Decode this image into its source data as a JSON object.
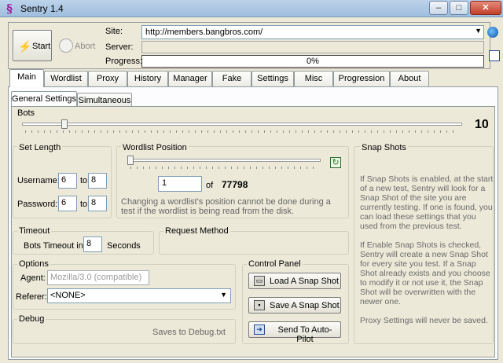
{
  "window": {
    "title": "Sentry 1.4",
    "icon_glyph": "§",
    "minimize_glyph": "–",
    "maximize_glyph": "□",
    "close_glyph": "✕"
  },
  "top": {
    "start_label": "Start",
    "start_icon": "⚡",
    "abort_label": "Abort",
    "site_label": "Site:",
    "site_value": "http://members.bangbros.com/",
    "combo_arrow": "▼",
    "server_label": "Server:",
    "progress_label": "Progress:",
    "progress_text": "0%",
    "progress_fraction": 0
  },
  "tabs": [
    {
      "label": "Main"
    },
    {
      "label": "Wordlist"
    },
    {
      "label": "Proxy"
    },
    {
      "label": "History"
    },
    {
      "label": "Manager"
    },
    {
      "label": "Fake"
    },
    {
      "label": "Settings"
    },
    {
      "label": "Misc"
    },
    {
      "label": "Progression"
    },
    {
      "label": "About"
    }
  ],
  "subtabs": [
    {
      "label": "General Settings"
    },
    {
      "label": "Simultaneous"
    }
  ],
  "bots": {
    "title": "Bots",
    "value": "10"
  },
  "set_length": {
    "title": "Set Length",
    "username_label": "Username:",
    "username_min": "6",
    "username_max": "8",
    "password_label": "Password:",
    "password_min": "6",
    "password_max": "8",
    "to": "to"
  },
  "wordlist_position": {
    "title": "Wordlist Position",
    "position": "1",
    "of": "of",
    "total": "77798",
    "note": "Changing a wordlist's position cannot be done during a test if the wordlist is being read from the disk."
  },
  "snap_shots": {
    "title": "Snap Shots",
    "para1": "If Snap Shots is enabled, at the start of a new test, Sentry will look for a Snap Shot of the site you are currently testing. If one is found, you can load these settings that you used from the previous test.",
    "para2": "If Enable Snap Shots is checked, Sentry will create a new Snap Shot for every site you test.  If a Snap Shot already exists and you choose to modify it or not use it, the Snap Shot will be overwritten with the newer one.",
    "para3": "Proxy Settings will never be saved."
  },
  "timeout": {
    "title": "Timeout",
    "label": "Bots Timeout in",
    "value": "8",
    "unit": "Seconds"
  },
  "request_method": {
    "title": "Request Method"
  },
  "options": {
    "title": "Options",
    "agent_label": "Agent:",
    "agent_placeholder": "Mozilla/3.0 (compatible)",
    "referer_label": "Referer:",
    "referer_value": "<NONE>"
  },
  "control_panel": {
    "title": "Control Panel",
    "load_label": "Load A Snap Shot",
    "save_label": "Save A Snap Shot",
    "autopilot_label": "Send To Auto-Pilot"
  },
  "debug": {
    "title": "Debug",
    "text": "Saves to Debug.txt"
  }
}
